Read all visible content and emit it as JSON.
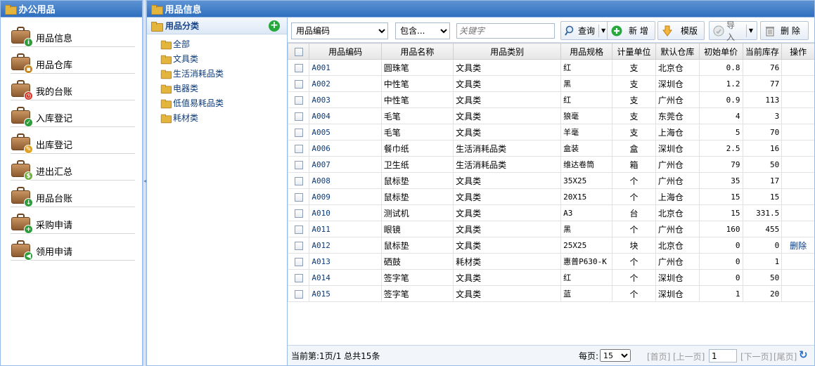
{
  "left_panel": {
    "title": "办公用品",
    "items": [
      {
        "label": "用品信息",
        "icon": "info-badge-icon",
        "badge": "i",
        "badge_color": "#2e9e3b"
      },
      {
        "label": "用品仓库",
        "icon": "lock-badge-icon",
        "badge": "▪",
        "badge_color": "#c6891d"
      },
      {
        "label": "我的台账",
        "icon": "clock-badge-icon",
        "badge": "◷",
        "badge_color": "#d03a2a"
      },
      {
        "label": "入库登记",
        "icon": "check-badge-icon",
        "badge": "✓",
        "badge_color": "#2e9e3b"
      },
      {
        "label": "出库登记",
        "icon": "pencil-badge-icon",
        "badge": "✎",
        "badge_color": "#e0a321"
      },
      {
        "label": "进出汇总",
        "icon": "dollar-badge-icon",
        "badge": "$",
        "badge_color": "#6fb23a"
      },
      {
        "label": "用品台账",
        "icon": "download-badge-icon",
        "badge": "↓",
        "badge_color": "#2e9e3b"
      },
      {
        "label": "采购申请",
        "icon": "plus-badge-icon",
        "badge": "+",
        "badge_color": "#2e9e3b"
      },
      {
        "label": "领用申请",
        "icon": "arrow-left-badge-icon",
        "badge": "◀",
        "badge_color": "#2e9e3b"
      }
    ]
  },
  "right_panel": {
    "title": "用品信息"
  },
  "tree": {
    "title": "用品分类",
    "nodes": [
      "全部",
      "文具类",
      "生活消耗品类",
      "电器类",
      "低值易耗品类",
      "耗材类"
    ]
  },
  "toolbar": {
    "field_select": "用品编码",
    "op_select": "包含...",
    "keyword_placeholder": "关键字",
    "search_label": "查询",
    "add_label": "新 增",
    "template_label": "模版",
    "import_label": "导 入",
    "delete_label": "删 除"
  },
  "grid": {
    "headers": [
      "用品编码",
      "用品名称",
      "用品类别",
      "用品规格",
      "计量单位",
      "默认仓库",
      "初始单价",
      "当前库存",
      "操作"
    ],
    "rows": [
      [
        "A001",
        "圆珠笔",
        "文具类",
        "红",
        "支",
        "北京仓",
        "0.8",
        "76",
        ""
      ],
      [
        "A002",
        "中性笔",
        "文具类",
        "黑",
        "支",
        "深圳仓",
        "1.2",
        "77",
        ""
      ],
      [
        "A003",
        "中性笔",
        "文具类",
        "红",
        "支",
        "广州仓",
        "0.9",
        "113",
        ""
      ],
      [
        "A004",
        "毛笔",
        "文具类",
        "狼毫",
        "支",
        "东莞仓",
        "4",
        "3",
        ""
      ],
      [
        "A005",
        "毛笔",
        "文具类",
        "羊毫",
        "支",
        "上海仓",
        "5",
        "70",
        ""
      ],
      [
        "A006",
        "餐巾纸",
        "生活消耗品类",
        "盒装",
        "盒",
        "深圳仓",
        "2.5",
        "16",
        ""
      ],
      [
        "A007",
        "卫生纸",
        "生活消耗品类",
        "维达卷筒",
        "箱",
        "广州仓",
        "79",
        "50",
        ""
      ],
      [
        "A008",
        "鼠标垫",
        "文具类",
        "35X25",
        "个",
        "广州仓",
        "35",
        "17",
        ""
      ],
      [
        "A009",
        "鼠标垫",
        "文具类",
        "20X15",
        "个",
        "上海仓",
        "15",
        "15",
        ""
      ],
      [
        "A010",
        "测试机",
        "文具类",
        "A3",
        "台",
        "北京仓",
        "15",
        "331.5",
        ""
      ],
      [
        "A011",
        "眼镜",
        "文具类",
        "黑",
        "个",
        "广州仓",
        "160",
        "455",
        ""
      ],
      [
        "A012",
        "鼠标垫",
        "文具类",
        "25X25",
        "块",
        "北京仓",
        "0",
        "0",
        "删除"
      ],
      [
        "A013",
        "硒鼓",
        "耗材类",
        "惠普P630-K",
        "个",
        "广州仓",
        "0",
        "1",
        ""
      ],
      [
        "A014",
        "签字笔",
        "文具类",
        "红",
        "个",
        "深圳仓",
        "0",
        "50",
        ""
      ],
      [
        "A015",
        "签字笔",
        "文具类",
        "蓝",
        "个",
        "深圳仓",
        "1",
        "20",
        ""
      ]
    ]
  },
  "pager": {
    "info": "当前第:1页/1 总共15条",
    "page_size_label": "每页:",
    "page_size": "15",
    "first": "[首页]",
    "prev": "[上一页]",
    "page_input": "1",
    "next": "[下一页]",
    "last": "[尾页]"
  }
}
